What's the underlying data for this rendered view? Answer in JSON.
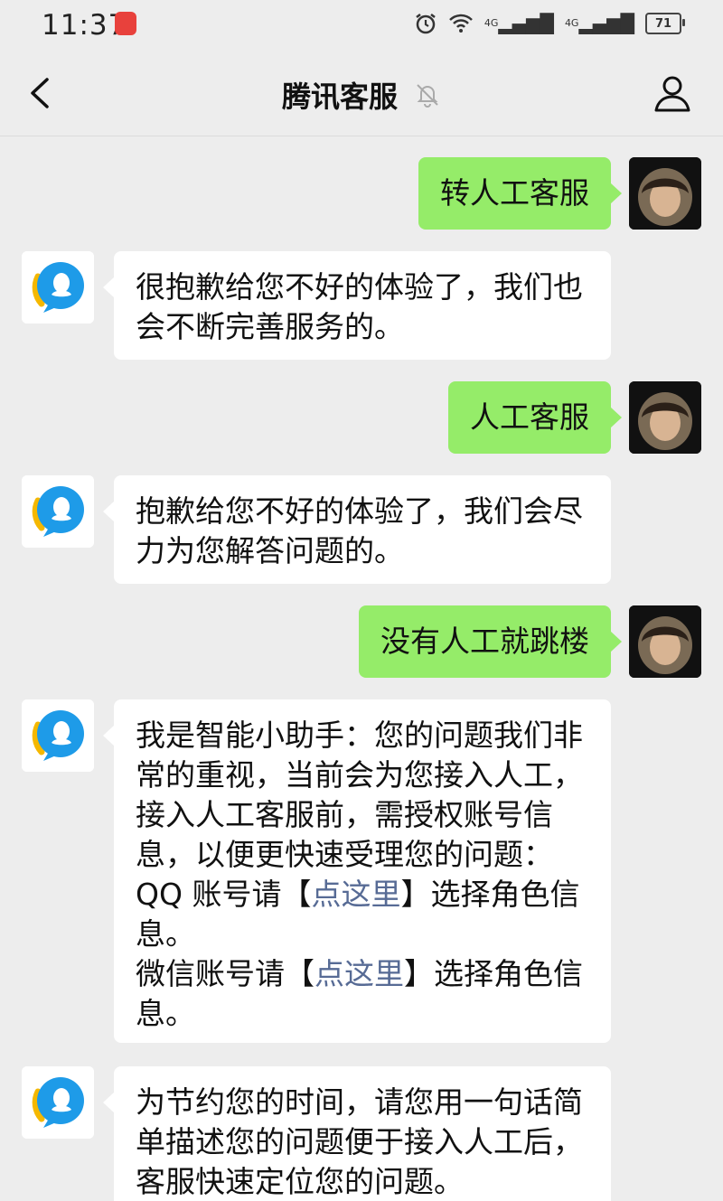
{
  "status_bar": {
    "time": "11:37",
    "network_1": "4G",
    "network_2": "4G",
    "battery": "71",
    "icons": [
      "app-notification-icon",
      "alarm-icon",
      "wifi-icon",
      "signal-icon",
      "signal-icon",
      "battery-icon"
    ]
  },
  "header": {
    "title": "腾讯客服",
    "icons": [
      "back-chevron-icon",
      "mute-bell-icon",
      "person-icon"
    ]
  },
  "messages": [
    {
      "sender": "user",
      "text": "转人工客服"
    },
    {
      "sender": "bot",
      "text": "很抱歉给您不好的体验了，我们也会不断完善服务的。"
    },
    {
      "sender": "user",
      "text": "人工客服"
    },
    {
      "sender": "bot",
      "text": "抱歉给您不好的体验了，我们会尽力为您解答问题的。"
    },
    {
      "sender": "user",
      "text": "没有人工就跳楼"
    },
    {
      "sender": "bot",
      "intro": "我是智能小助手：您的问题我们非常的重视，当前会为您接入人工，接入人工客服前，需授权账号信息，以便更快速受理您的问题：",
      "qq_prefix": "QQ 账号请【",
      "qq_link": "点这里",
      "qq_suffix": "】选择角色信息。",
      "wx_prefix": "微信账号请【",
      "wx_link": "点这里",
      "wx_suffix": "】选择角色信息。"
    },
    {
      "sender": "bot",
      "text": "为节约您的时间，请您用一句话简单描述您的问题便于接入人工后，客服快速定位您的问题。"
    }
  ],
  "colors": {
    "background": "#ededed",
    "user_bubble": "#95ec69",
    "bot_bubble": "#ffffff",
    "link": "#576b95",
    "qq_blue": "#1e9be8",
    "qq_yellow": "#f5b800"
  }
}
